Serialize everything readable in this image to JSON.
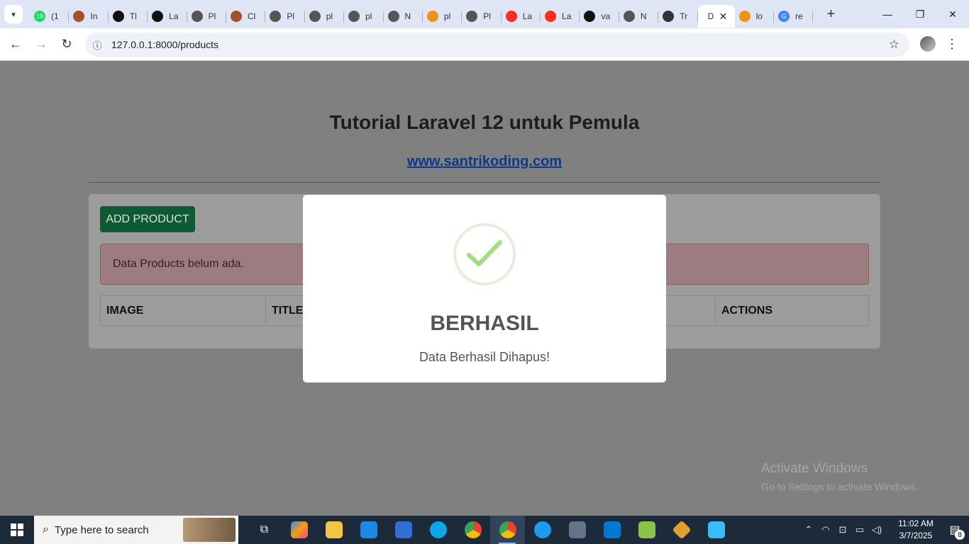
{
  "browser": {
    "tabs": [
      {
        "title": "(1",
        "icon": "whatsapp-icon",
        "color": "#25d366"
      },
      {
        "title": "In",
        "icon": "avatar-icon",
        "color": "#a0522d"
      },
      {
        "title": "Tl",
        "icon": "github-icon",
        "color": "#111111"
      },
      {
        "title": "La",
        "icon": "chatgpt-icon",
        "color": "#111111"
      },
      {
        "title": "Pl",
        "icon": "globe-icon",
        "color": "#555555"
      },
      {
        "title": "Cl",
        "icon": "avatar-icon",
        "color": "#a0522d"
      },
      {
        "title": "Pl",
        "icon": "globe-icon",
        "color": "#555555"
      },
      {
        "title": "pl",
        "icon": "globe-icon",
        "color": "#555555"
      },
      {
        "title": "pl",
        "icon": "globe-icon",
        "color": "#555555"
      },
      {
        "title": "N",
        "icon": "globe-icon",
        "color": "#555555"
      },
      {
        "title": "pl",
        "icon": "phpmyadmin-icon",
        "color": "#f29111"
      },
      {
        "title": "Pl",
        "icon": "globe-icon",
        "color": "#555555"
      },
      {
        "title": "La",
        "icon": "laravel-icon",
        "color": "#ff2d20"
      },
      {
        "title": "La",
        "icon": "laravel-icon",
        "color": "#ff2d20"
      },
      {
        "title": "va",
        "icon": "github-icon",
        "color": "#111111"
      },
      {
        "title": "N",
        "icon": "globe-icon",
        "color": "#555555"
      },
      {
        "title": "Tr",
        "icon": "copilot-icon",
        "color": "#333333"
      }
    ],
    "active_tab": {
      "title": "D",
      "close": "✕"
    },
    "after_tabs": [
      {
        "title": "lo",
        "icon": "phpmyadmin-icon",
        "color": "#f29111"
      },
      {
        "title": "re",
        "icon": "google-icon",
        "color": "#4285f4"
      }
    ],
    "new_tab": "+",
    "url": "127.0.0.1:8000/products"
  },
  "page": {
    "title": "Tutorial Laravel 12 untuk Pemula",
    "link": "www.santrikoding.com",
    "add_button": "ADD PRODUCT",
    "alert": "Data Products belum ada.",
    "table_headers": [
      "IMAGE",
      "TITLE",
      "",
      "",
      "ACTIONS"
    ]
  },
  "modal": {
    "title": "BERHASIL",
    "text": "Data Berhasil Dihapus!",
    "icon": "checkmark-icon",
    "accent": "#a5dc86"
  },
  "watermark": {
    "line1": "Activate Windows",
    "line2": "Go to Settings to activate Windows."
  },
  "taskbar": {
    "search_placeholder": "Type here to search",
    "time": "11:02 AM",
    "date": "3/7/2025",
    "notification_count": "8"
  }
}
